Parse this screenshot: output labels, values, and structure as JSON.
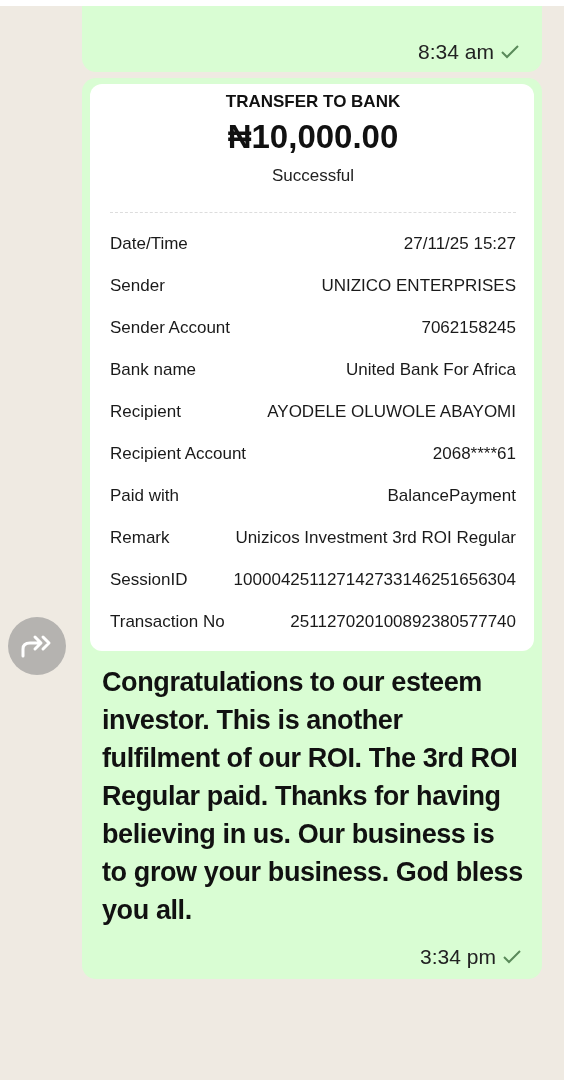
{
  "previous_message": {
    "time": "8:34 am"
  },
  "receipt_message": {
    "receipt": {
      "title": "TRANSFER TO BANK",
      "amount": "₦10,000.00",
      "status": "Successful",
      "rows": [
        {
          "label": "Date/Time",
          "value": "27/11/25 15:27"
        },
        {
          "label": "Sender",
          "value": "UNIZICO ENTERPRISES"
        },
        {
          "label": "Sender Account",
          "value": "7062158245"
        },
        {
          "label": "Bank name",
          "value": "United Bank For Africa"
        },
        {
          "label": "Recipient",
          "value": "AYODELE OLUWOLE ABAYOMI"
        },
        {
          "label": "Recipient Account",
          "value": "2068****61"
        },
        {
          "label": "Paid with",
          "value": "BalancePayment"
        },
        {
          "label": "Remark",
          "value": "Unizicos Investment 3rd ROI Regular"
        },
        {
          "label": "SessionID",
          "value": "100004251127142733146251656304"
        },
        {
          "label": "Transaction No",
          "value": "251127020100892380577740"
        }
      ]
    },
    "text": "Congratulations to our esteem investor. This is another fulfilment of our ROI. The 3rd ROI Regular paid. Thanks for having believing in us. Our business is to grow your business. God bless you all.",
    "time": "3:34 pm"
  }
}
